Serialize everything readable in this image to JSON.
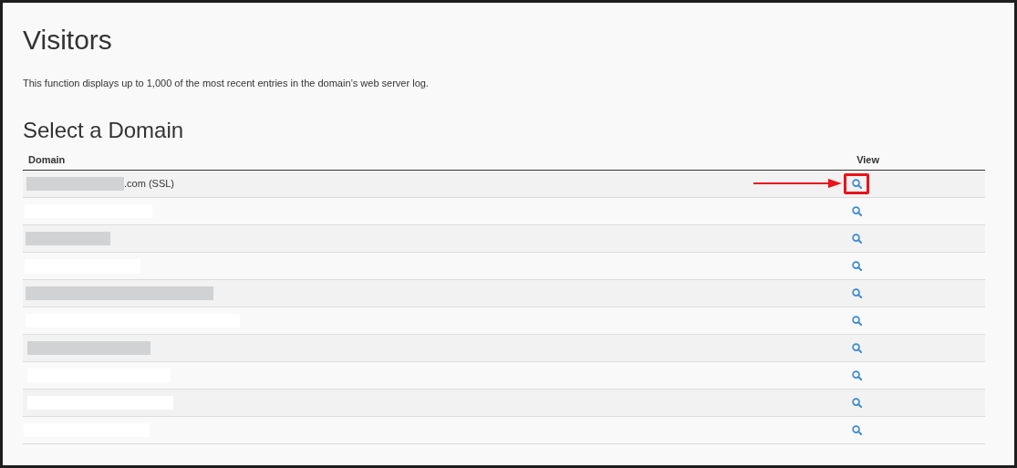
{
  "title": "Visitors",
  "description": "This function displays up to 1,000 of the most recent entries in the domain’s web server log.",
  "section_title": "Select a Domain",
  "table": {
    "columns": [
      "Domain",
      "View"
    ],
    "rows": [
      {
        "domain": ".com (SSL)",
        "highlighted": true
      },
      {
        "highlighted": false
      },
      {
        "highlighted": false
      },
      {
        "highlighted": false
      },
      {
        "highlighted": false
      },
      {
        "highlighted": false
      },
      {
        "highlighted": false
      },
      {
        "highlighted": false
      },
      {
        "highlighted": false
      },
      {
        "highlighted": false
      }
    ]
  }
}
